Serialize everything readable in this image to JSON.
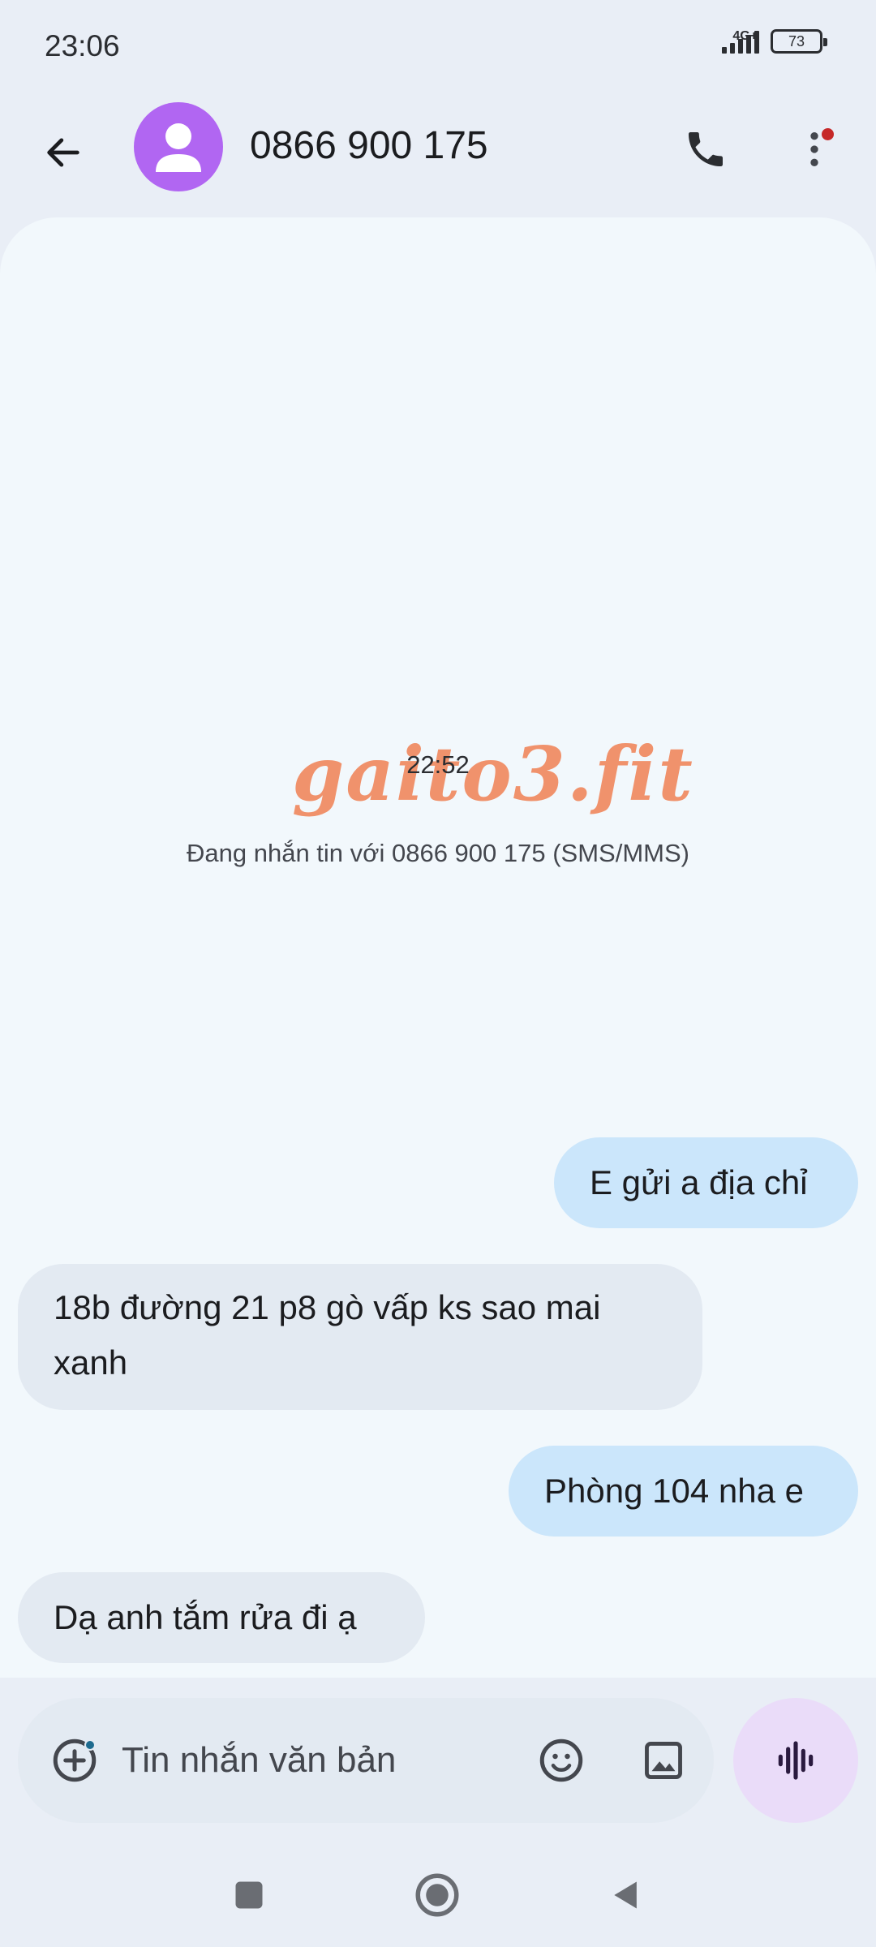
{
  "status_bar": {
    "time": "23:06",
    "network": "4G+",
    "battery": "73"
  },
  "header": {
    "title": "0866 900 175"
  },
  "conversation": {
    "watermark": "gaito3.fit",
    "timestamp": "22:52",
    "info": "Đang nhắn tin với 0866 900 175 (SMS/MMS)",
    "messages": [
      {
        "direction": "out",
        "text": "E gửi a địa chỉ"
      },
      {
        "direction": "in",
        "line1": "18b đường 21 p8 gò vấp ks sao mai",
        "line2": "xanh"
      },
      {
        "direction": "out",
        "text": "Phòng 104 nha e"
      },
      {
        "direction": "in",
        "text": "Dạ anh tắm rửa đi ạ"
      }
    ]
  },
  "composer": {
    "placeholder": "Tin nhắn văn bản",
    "value": ""
  },
  "colors": {
    "avatar": "#b166f2",
    "outgoing_bubble": "#cbe6fb",
    "incoming_bubble": "#e3eaf2",
    "voice_button": "#eadcf9",
    "watermark": "#f08a60"
  },
  "icons": {
    "back": "arrow-left",
    "call": "phone",
    "more": "more-vertical",
    "add": "add-circle",
    "emoji": "smile",
    "gallery": "image",
    "voice": "waveform",
    "nav_recents": "square",
    "nav_home": "circle",
    "nav_back": "triangle-left"
  }
}
